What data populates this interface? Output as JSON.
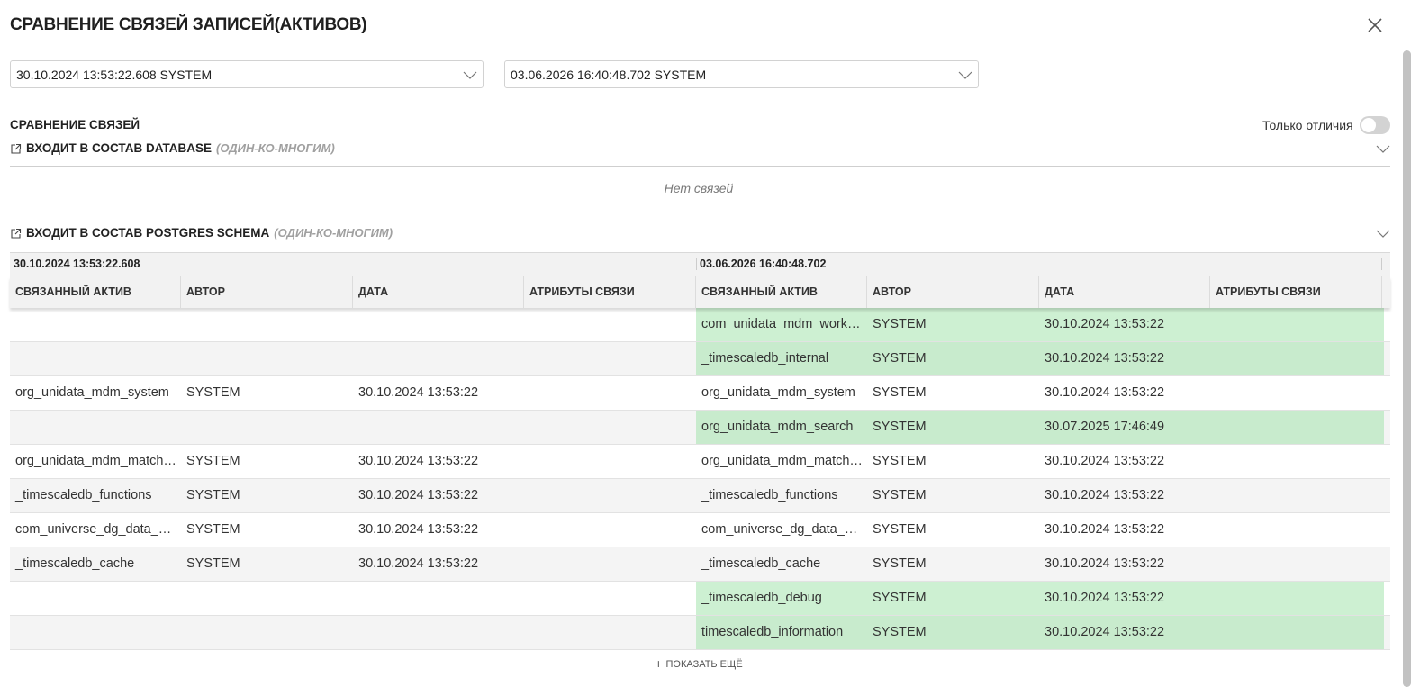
{
  "dialog": {
    "title": "СРАВНЕНИЕ СВЯЗЕЙ ЗАПИСЕЙ(АКТИВОВ)",
    "version_left": "30.10.2024 13:53:22.608 SYSTEM",
    "version_right": "03.06.2026 16:40:48.702 SYSTEM"
  },
  "compare": {
    "section_label": "СРАВНЕНИЕ СВЯЗЕЙ",
    "only_diff_label": "Только отличия",
    "only_diff_on": false
  },
  "groups": [
    {
      "title": "ВХОДИТ В СОСТАВ DATABASE",
      "cardinality": "(ОДИН-КО-МНОГИМ)",
      "empty_text": "Нет связей"
    },
    {
      "title": "ВХОДИТ В СОСТАВ POSTGRES SCHEMA",
      "cardinality": "(ОДИН-КО-МНОГИМ)"
    }
  ],
  "table": {
    "left_version": "30.10.2024 13:53:22.608",
    "right_version": "03.06.2026 16:40:48.702",
    "columns": [
      "СВЯЗАННЫЙ АКТИВ",
      "АВТОР",
      "ДАТА",
      "АТРИБУТЫ СВЯЗИ"
    ],
    "rows": [
      {
        "left": [
          "",
          "",
          "",
          ""
        ],
        "right": [
          "com_unidata_mdm_work…",
          "SYSTEM",
          "30.10.2024 13:53:22",
          ""
        ],
        "added": true
      },
      {
        "left": [
          "",
          "",
          "",
          ""
        ],
        "right": [
          "_timescaledb_internal",
          "SYSTEM",
          "30.10.2024 13:53:22",
          ""
        ],
        "added": true
      },
      {
        "left": [
          "org_unidata_mdm_system",
          "SYSTEM",
          "30.10.2024 13:53:22",
          ""
        ],
        "right": [
          "org_unidata_mdm_system",
          "SYSTEM",
          "30.10.2024 13:53:22",
          ""
        ],
        "added": false
      },
      {
        "left": [
          "",
          "",
          "",
          ""
        ],
        "right": [
          "org_unidata_mdm_search",
          "SYSTEM",
          "30.07.2025 17:46:49",
          ""
        ],
        "added": true
      },
      {
        "left": [
          "org_unidata_mdm_match…",
          "SYSTEM",
          "30.10.2024 13:53:22",
          ""
        ],
        "right": [
          "org_unidata_mdm_match…",
          "SYSTEM",
          "30.10.2024 13:53:22",
          ""
        ],
        "added": false
      },
      {
        "left": [
          "_timescaledb_functions",
          "SYSTEM",
          "30.10.2024 13:53:22",
          ""
        ],
        "right": [
          "_timescaledb_functions",
          "SYSTEM",
          "30.10.2024 13:53:22",
          ""
        ],
        "added": false
      },
      {
        "left": [
          "com_universe_dg_data_…",
          "SYSTEM",
          "30.10.2024 13:53:22",
          ""
        ],
        "right": [
          "com_universe_dg_data_…",
          "SYSTEM",
          "30.10.2024 13:53:22",
          ""
        ],
        "added": false
      },
      {
        "left": [
          "_timescaledb_cache",
          "SYSTEM",
          "30.10.2024 13:53:22",
          ""
        ],
        "right": [
          "_timescaledb_cache",
          "SYSTEM",
          "30.10.2024 13:53:22",
          ""
        ],
        "added": false
      },
      {
        "left": [
          "",
          "",
          "",
          ""
        ],
        "right": [
          "_timescaledb_debug",
          "SYSTEM",
          "30.10.2024 13:53:22",
          ""
        ],
        "added": true
      },
      {
        "left": [
          "",
          "",
          "",
          ""
        ],
        "right": [
          "timescaledb_information",
          "SYSTEM",
          "30.10.2024 13:53:22",
          ""
        ],
        "added": true
      }
    ],
    "show_more_label": "ПОКАЗАТЬ ЕЩЁ"
  },
  "colors": {
    "added_row": "#cdf0d2",
    "header_bg": "#f2f2f2",
    "toggle_off": "#d3d3d3"
  }
}
